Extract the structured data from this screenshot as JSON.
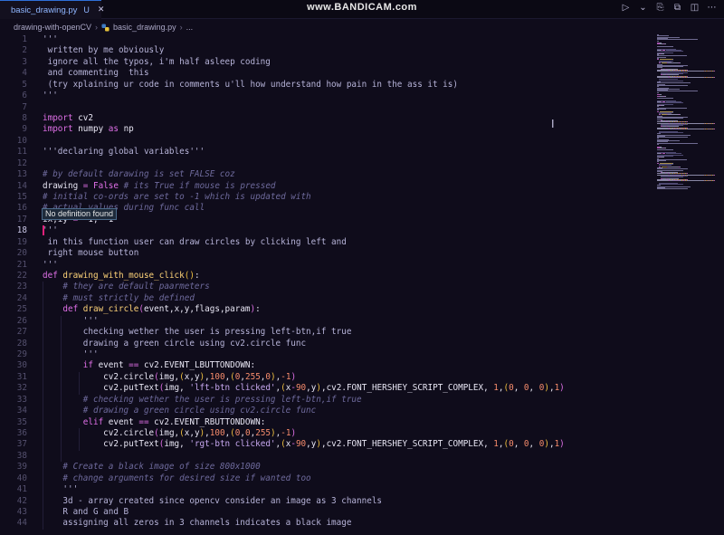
{
  "tab": {
    "file_name": "basic_drawing.py",
    "badge": "U",
    "close": "✕"
  },
  "watermark": "www.BANDICAM.com",
  "breadcrumb": {
    "folder": "drawing-with-openCV",
    "file": "basic_drawing.py",
    "more": "..."
  },
  "tooltip": "No definition found",
  "lines": [
    {
      "n": "1",
      "t": [
        [
          "st",
          "'''"
        ]
      ]
    },
    {
      "n": "2",
      "t": [
        [
          "st",
          " written by me obviously"
        ]
      ]
    },
    {
      "n": "3",
      "t": [
        [
          "st",
          " ignore all the typos, i'm half asleep coding"
        ]
      ]
    },
    {
      "n": "4",
      "t": [
        [
          "st",
          " and commenting  this"
        ]
      ]
    },
    {
      "n": "5",
      "t": [
        [
          "st",
          " (try xplaining ur code in comments u'll how understand how pain in the ass it is)"
        ]
      ]
    },
    {
      "n": "6",
      "t": [
        [
          "st",
          "'''"
        ]
      ]
    },
    {
      "n": "7",
      "t": []
    },
    {
      "n": "8",
      "t": [
        [
          "kw",
          "import"
        ],
        [
          "pl",
          " cv2"
        ]
      ]
    },
    {
      "n": "9",
      "t": [
        [
          "kw",
          "import"
        ],
        [
          "pl",
          " numpy "
        ],
        [
          "kw",
          "as"
        ],
        [
          "pl",
          " np"
        ]
      ]
    },
    {
      "n": "10",
      "t": []
    },
    {
      "n": "11",
      "t": [
        [
          "st",
          "'''declaring global variables'''"
        ]
      ]
    },
    {
      "n": "12",
      "t": []
    },
    {
      "n": "13",
      "t": [
        [
          "cm",
          "# by default darawing is set FALSE coz"
        ]
      ]
    },
    {
      "n": "14",
      "t": [
        [
          "pl",
          "drawing "
        ],
        [
          "kw",
          "="
        ],
        [
          "pl",
          " "
        ],
        [
          "kw",
          "False"
        ],
        [
          "pl",
          " "
        ],
        [
          "cm",
          "# its True if mouse is pressed"
        ]
      ]
    },
    {
      "n": "15",
      "t": [
        [
          "cm",
          "# initial co-ords are set to -1 which is updated with"
        ]
      ]
    },
    {
      "n": "16",
      "t": [
        [
          "cm",
          "# actual values during func call"
        ]
      ]
    },
    {
      "n": "17",
      "t": [
        [
          "pl",
          "ix,iy "
        ],
        [
          "kw",
          "="
        ],
        [
          "pl",
          " -1, -1"
        ]
      ]
    },
    {
      "n": "18",
      "t": [
        [
          "st",
          "'''"
        ]
      ]
    },
    {
      "n": "19",
      "t": [
        [
          "st",
          " in this function user can draw circles by clicking left and"
        ]
      ]
    },
    {
      "n": "20",
      "t": [
        [
          "st",
          " right mouse button"
        ]
      ]
    },
    {
      "n": "21",
      "t": [
        [
          "st",
          "'''"
        ]
      ]
    },
    {
      "n": "22",
      "t": [
        [
          "kw",
          "def"
        ],
        [
          "pl",
          " "
        ],
        [
          "fn",
          "drawing_with_mouse_click"
        ],
        [
          "br",
          "()"
        ],
        [
          "pl",
          ":"
        ]
      ]
    },
    {
      "n": "23",
      "t": [
        [
          "pl",
          "    "
        ],
        [
          "cm",
          "# they are default paarmeters"
        ]
      ]
    },
    {
      "n": "24",
      "t": [
        [
          "pl",
          "    "
        ],
        [
          "cm",
          "# must strictly be defined"
        ]
      ]
    },
    {
      "n": "25",
      "t": [
        [
          "pl",
          "    "
        ],
        [
          "kw",
          "def"
        ],
        [
          "pl",
          " "
        ],
        [
          "fn",
          "draw_circle"
        ],
        [
          "br2",
          "("
        ],
        [
          "pl",
          "event,x,y,flags,param"
        ],
        [
          "br2",
          ")"
        ],
        [
          "pl",
          ":"
        ]
      ]
    },
    {
      "n": "26",
      "t": [
        [
          "st",
          "        '''"
        ]
      ]
    },
    {
      "n": "27",
      "t": [
        [
          "st",
          "        checking wether the user is pressing left-btn,if true"
        ]
      ]
    },
    {
      "n": "28",
      "t": [
        [
          "st",
          "        drawing a green circle using cv2.circle func"
        ]
      ]
    },
    {
      "n": "29",
      "t": [
        [
          "st",
          "        '''"
        ]
      ]
    },
    {
      "n": "30",
      "t": [
        [
          "pl",
          "        "
        ],
        [
          "kw",
          "if"
        ],
        [
          "pl",
          " event "
        ],
        [
          "kw",
          "=="
        ],
        [
          "pl",
          " cv2.EVENT_LBUTTONDOWN:"
        ]
      ]
    },
    {
      "n": "31",
      "t": [
        [
          "pl",
          "            cv2.circle"
        ],
        [
          "br2",
          "("
        ],
        [
          "pl",
          "img,"
        ],
        [
          "br",
          "("
        ],
        [
          "pl",
          "x,y"
        ],
        [
          "br",
          ")"
        ],
        [
          "pl",
          ","
        ],
        [
          "num",
          "100"
        ],
        [
          "pl",
          ","
        ],
        [
          "br",
          "("
        ],
        [
          "num",
          "0"
        ],
        [
          "pl",
          ","
        ],
        [
          "num",
          "255"
        ],
        [
          "pl",
          ","
        ],
        [
          "num",
          "0"
        ],
        [
          "br",
          ")"
        ],
        [
          "pl",
          ","
        ],
        [
          "num",
          "-1"
        ],
        [
          "br2",
          ")"
        ]
      ]
    },
    {
      "n": "32",
      "t": [
        [
          "pl",
          "            cv2.putText"
        ],
        [
          "br2",
          "("
        ],
        [
          "pl",
          "img, "
        ],
        [
          "str",
          "'lft-btn clicked'"
        ],
        [
          "pl",
          ","
        ],
        [
          "br",
          "("
        ],
        [
          "pl",
          "x"
        ],
        [
          "kw",
          "-"
        ],
        [
          "num",
          "90"
        ],
        [
          "pl",
          ",y"
        ],
        [
          "br",
          ")"
        ],
        [
          "pl",
          ",cv2.FONT_HERSHEY_SCRIPT_COMPLEX, "
        ],
        [
          "num",
          "1"
        ],
        [
          "pl",
          ","
        ],
        [
          "br",
          "("
        ],
        [
          "num",
          "0"
        ],
        [
          "pl",
          ", "
        ],
        [
          "num",
          "0"
        ],
        [
          "pl",
          ", "
        ],
        [
          "num",
          "0"
        ],
        [
          "br",
          ")"
        ],
        [
          "pl",
          ","
        ],
        [
          "num",
          "1"
        ],
        [
          "br2",
          ")"
        ]
      ]
    },
    {
      "n": "33",
      "t": [
        [
          "pl",
          "        "
        ],
        [
          "cm",
          "# checking wether the user is pressing left-btn,if true"
        ]
      ]
    },
    {
      "n": "34",
      "t": [
        [
          "pl",
          "        "
        ],
        [
          "cm",
          "# drawing a green circle using cv2.circle func"
        ]
      ]
    },
    {
      "n": "35",
      "t": [
        [
          "pl",
          "        "
        ],
        [
          "kw",
          "elif"
        ],
        [
          "pl",
          " event "
        ],
        [
          "kw",
          "=="
        ],
        [
          "pl",
          " cv2.EVENT_RBUTTONDOWN:"
        ]
      ]
    },
    {
      "n": "36",
      "t": [
        [
          "pl",
          "            cv2.circle"
        ],
        [
          "br2",
          "("
        ],
        [
          "pl",
          "img,"
        ],
        [
          "br",
          "("
        ],
        [
          "pl",
          "x,y"
        ],
        [
          "br",
          ")"
        ],
        [
          "pl",
          ","
        ],
        [
          "num",
          "100"
        ],
        [
          "pl",
          ","
        ],
        [
          "br",
          "("
        ],
        [
          "num",
          "0"
        ],
        [
          "pl",
          ","
        ],
        [
          "num",
          "0"
        ],
        [
          "pl",
          ","
        ],
        [
          "num",
          "255"
        ],
        [
          "br",
          ")"
        ],
        [
          "pl",
          ","
        ],
        [
          "num",
          "-1"
        ],
        [
          "br2",
          ")"
        ]
      ]
    },
    {
      "n": "37",
      "t": [
        [
          "pl",
          "            cv2.putText"
        ],
        [
          "br2",
          "("
        ],
        [
          "pl",
          "img, "
        ],
        [
          "str",
          "'rgt-btn clicked'"
        ],
        [
          "pl",
          ","
        ],
        [
          "br",
          "("
        ],
        [
          "pl",
          "x"
        ],
        [
          "kw",
          "-"
        ],
        [
          "num",
          "90"
        ],
        [
          "pl",
          ",y"
        ],
        [
          "br",
          ")"
        ],
        [
          "pl",
          ",cv2.FONT_HERSHEY_SCRIPT_COMPLEX, "
        ],
        [
          "num",
          "1"
        ],
        [
          "pl",
          ","
        ],
        [
          "br",
          "("
        ],
        [
          "num",
          "0"
        ],
        [
          "pl",
          ", "
        ],
        [
          "num",
          "0"
        ],
        [
          "pl",
          ", "
        ],
        [
          "num",
          "0"
        ],
        [
          "br",
          ")"
        ],
        [
          "pl",
          ","
        ],
        [
          "num",
          "1"
        ],
        [
          "br2",
          ")"
        ]
      ]
    },
    {
      "n": "38",
      "t": []
    },
    {
      "n": "39",
      "t": [
        [
          "pl",
          "    "
        ],
        [
          "cm",
          "# Create a black image of size 800x1000"
        ]
      ]
    },
    {
      "n": "40",
      "t": [
        [
          "pl",
          "    "
        ],
        [
          "cm",
          "# change arguments for desired size if wanted too"
        ]
      ]
    },
    {
      "n": "41",
      "t": [
        [
          "st",
          "    '''"
        ]
      ]
    },
    {
      "n": "42",
      "t": [
        [
          "st",
          "    3d - array created since opencv consider an image as 3 channels"
        ]
      ]
    },
    {
      "n": "43",
      "t": [
        [
          "st",
          "    R and G and B"
        ]
      ]
    },
    {
      "n": "44",
      "t": [
        [
          "st",
          "    assigning all zeros in 3 channels indicates a black image"
        ]
      ]
    }
  ],
  "colors": {
    "accent": "#2e6fd8",
    "cursor": "#e0207a",
    "background": "#0f0c1b"
  }
}
